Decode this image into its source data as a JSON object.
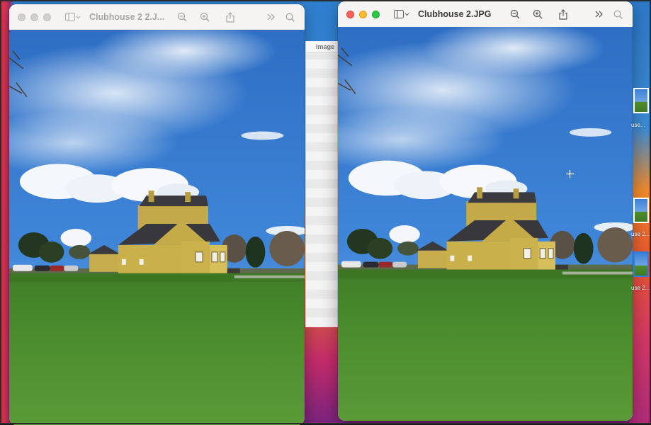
{
  "left_window": {
    "title": "Clubhouse 2 2.J...",
    "state": "inactive",
    "toolbar": [
      "sidebar-icon",
      "zoom-out-icon",
      "zoom-in-icon",
      "share-icon",
      "more-icon",
      "search-icon"
    ]
  },
  "right_window": {
    "title": "Clubhouse 2.JPG",
    "state": "active",
    "toolbar": [
      "sidebar-icon",
      "zoom-out-icon",
      "zoom-in-icon",
      "share-icon",
      "more-icon",
      "search-icon"
    ]
  },
  "background_window": {
    "header": "Image"
  },
  "desktop_files": [
    {
      "label": "use..."
    },
    {
      "label": "use 2..."
    },
    {
      "label": "use 2..."
    }
  ],
  "colors": {
    "sky": "#3a7fd5",
    "grass": "#4a8a2c",
    "building": "#c9b04a",
    "roof": "#3b3a3f"
  }
}
